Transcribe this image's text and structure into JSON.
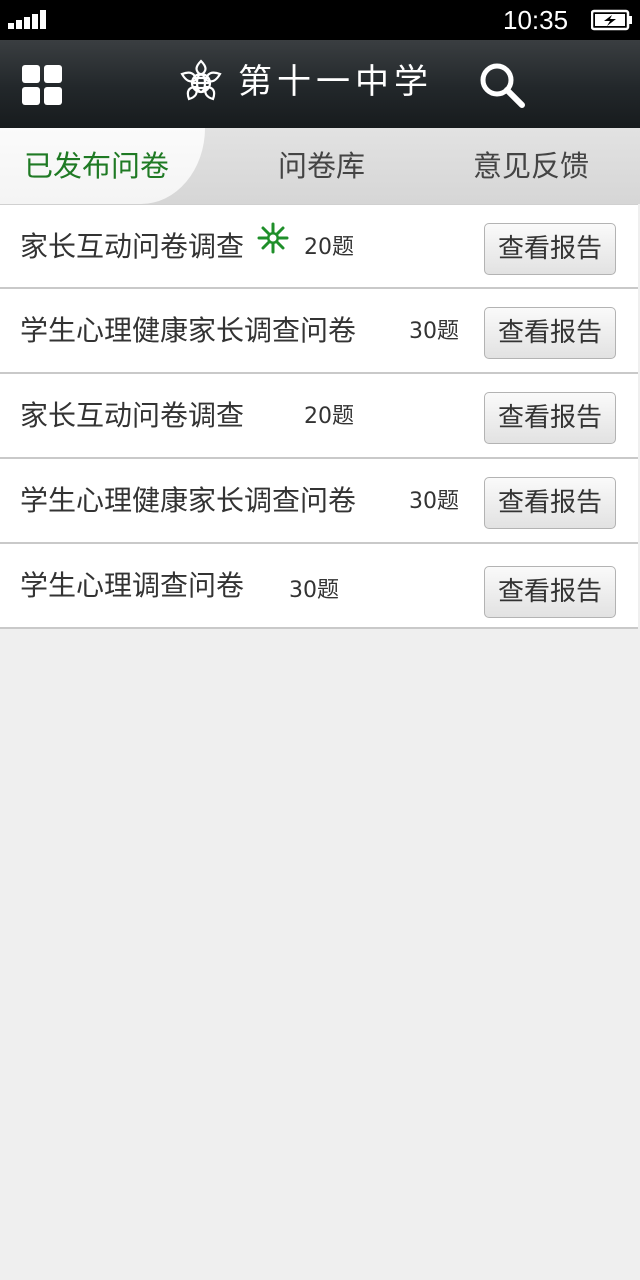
{
  "status_bar": {
    "time": "10:35"
  },
  "header": {
    "title": "第十一中学"
  },
  "tabs": [
    {
      "label": "已发布问卷",
      "active": true
    },
    {
      "label": "问卷库",
      "active": false
    },
    {
      "label": "意见反馈",
      "active": false
    }
  ],
  "surveys": [
    {
      "title": "家长互动问卷调查",
      "count": "20题",
      "is_new": true,
      "button": "查看报告"
    },
    {
      "title": "学生心理健康家长调查问卷",
      "count": "30题",
      "is_new": false,
      "button": "查看报告"
    },
    {
      "title": "家长互动问卷调查",
      "count": "20题",
      "is_new": false,
      "button": "查看报告"
    },
    {
      "title": "学生心理健康家长调查问卷",
      "count": "30题",
      "is_new": false,
      "button": "查看报告"
    },
    {
      "title": "学生心理调查问卷",
      "count": "30题",
      "is_new": false,
      "button": "查看报告"
    }
  ],
  "colors": {
    "accent": "#1f7a24",
    "header_bg": "#22272a",
    "background": "#efefef"
  },
  "icons": {
    "menu": "grid-menu-icon",
    "logo": "school-logo-icon",
    "search": "search-icon",
    "new": "new-star-icon",
    "signal": "signal-icon",
    "battery": "battery-charging-icon"
  }
}
